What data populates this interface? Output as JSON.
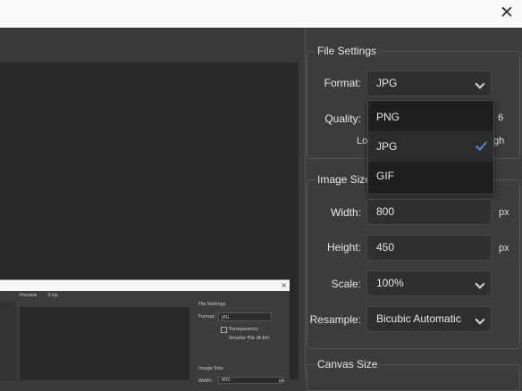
{
  "window": {
    "close_glyph": "✕"
  },
  "thumbnail": {
    "close_glyph": "×",
    "tabs": [
      "Preview",
      "2-Up"
    ],
    "file_settings": "File Settings",
    "format_label": "Format:",
    "format_value": "JPG",
    "transparency": "Transparency",
    "smaller_file": "Smaller File (8-bit)",
    "image_size": "Image Size",
    "width_label": "Width:",
    "width_value": "800",
    "unit": "px"
  },
  "file_settings": {
    "title": "File Settings",
    "format_label": "Format:",
    "format_value": "JPG",
    "quality_label": "Quality:",
    "quality_value_partial": "6",
    "quality_low_partial": "Lo",
    "quality_high_partial": "gh"
  },
  "format_dropdown": {
    "options": [
      "PNG",
      "JPG",
      "GIF"
    ],
    "selected": "JPG"
  },
  "image_size": {
    "title": "Image Size",
    "width_label": "Width:",
    "width_value": "800",
    "height_label": "Height:",
    "height_value": "450",
    "unit": "px",
    "scale_label": "Scale:",
    "scale_value": "100%",
    "resample_label": "Resample:",
    "resample_value": "Bicubic Automatic"
  },
  "canvas_size": {
    "title": "Canvas Size"
  }
}
